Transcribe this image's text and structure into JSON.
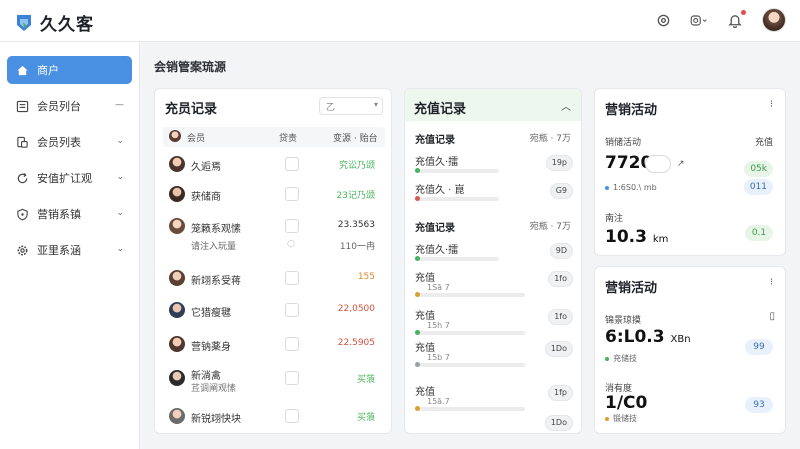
{
  "app": {
    "brand": "久久客"
  },
  "sidebar": {
    "items": [
      {
        "label": "商户",
        "icon": "home-icon",
        "active": true
      },
      {
        "label": "会员列台",
        "icon": "list-icon",
        "expander": "—"
      },
      {
        "label": "会员列表",
        "icon": "users-icon",
        "expander": "⌄"
      },
      {
        "label": "安值扩讧观",
        "icon": "refresh-icon",
        "expander": "⌄"
      },
      {
        "label": "营销系镇",
        "icon": "shield-icon",
        "expander": "⌄"
      },
      {
        "label": "亚里系涵",
        "icon": "gear-icon",
        "expander": "⌄"
      }
    ]
  },
  "main": {
    "title": "会销管案琉源"
  },
  "members": {
    "title": "充员记录",
    "filter": "乙",
    "headers": {
      "name": "会员",
      "col2": "贷责",
      "col3": "变源 · 贻台"
    },
    "rows": [
      {
        "name": "久逅焉",
        "value": "究讼乃颂",
        "color": "green"
      },
      {
        "name": "获储商",
        "value": "23记乃颂",
        "color": "green"
      },
      {
        "name": "笼籁系观愫",
        "value": "23.3563",
        "color": "dark"
      },
      {
        "name": "新翊系受蒋",
        "value": "155",
        "color": "orange"
      },
      {
        "name": "它猎瘦毽",
        "value": "22,0500",
        "color": "red"
      },
      {
        "name": "营钠薬身",
        "value": "22.5905",
        "color": "red"
      },
      {
        "name": "新淌禽",
        "value": "买蒗",
        "color": "green",
        "sub": "茊调阐观愫"
      },
      {
        "name": "新锐翊快块",
        "value": "买蒗",
        "color": "green"
      }
    ],
    "subline": {
      "label": "请注入玩量",
      "value": "110一冉"
    }
  },
  "recharge": {
    "title": "充值记录",
    "sections": [
      {
        "title": "充值记录",
        "right": "宛瓶 · 7万",
        "rows": [
          {
            "label": "充值久·擂",
            "pill": "19p",
            "dot": "#47b35a",
            "sub": ""
          },
          {
            "label": "充值久 · 崑",
            "pill": "G9",
            "dot": "#d95a4a",
            "sub": ""
          }
        ]
      },
      {
        "title": "充值记录",
        "right": "宛瓶 · 7万",
        "rows": [
          {
            "label": "充值久·擂",
            "pill": "9D",
            "dot": "#47b35a",
            "sub": ""
          },
          {
            "label": "充值",
            "pill": "1fo",
            "dot": "#d9a22a",
            "sub": "1Sā 7"
          },
          {
            "label": "充值",
            "pill": "1fo",
            "dot": "#47b35a",
            "sub": "15h 7"
          },
          {
            "label": "充值",
            "pill": "1Do",
            "dot": "#9aa0a6",
            "sub": "15b 7"
          },
          {
            "label": "充值",
            "pill": "1fp",
            "dot": "#d9a22a",
            "sub": "15ā.7"
          },
          {
            "label": "",
            "pill": "1Do",
            "dot": "",
            "sub": ""
          }
        ]
      }
    ]
  },
  "marketing1": {
    "title": "营销活动",
    "more": "⁝",
    "k1": "销储活动",
    "k1_right": "充值",
    "big1": "7720",
    "big1_badge": "05k",
    "meta1": "1:6S0.\\ mb",
    "meta1_badge": "011",
    "k2": "南注",
    "big2": "10.3",
    "big2_unit": "km",
    "big2_badge": "0.1"
  },
  "marketing2": {
    "title": "营销活动",
    "more": "⁝",
    "k1": "锦景琼摸",
    "big1": "6:L0.3",
    "big1_unit": "XBn",
    "meta1": "充储技",
    "badge1": "99",
    "k2": "消有度",
    "big2": "1/C0",
    "meta2": "锻储技",
    "badge2": "93"
  },
  "colors": {
    "accent": "#4a90e2",
    "green": "#47b35a",
    "red": "#d2523d",
    "orange": "#d9892a"
  }
}
